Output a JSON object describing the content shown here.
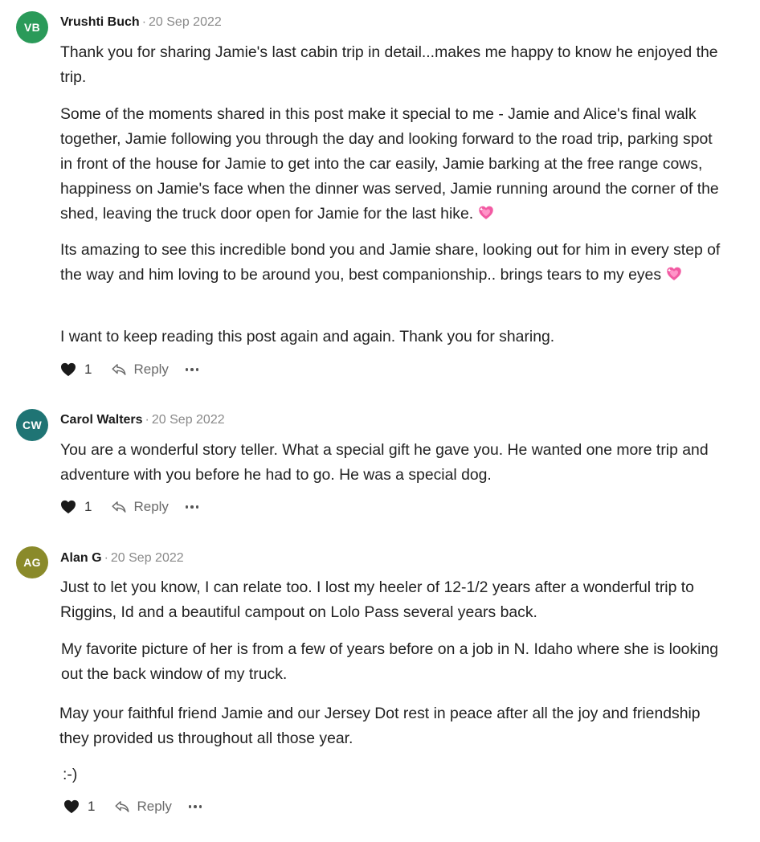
{
  "colors": {
    "avatar_vb": "#2a9a59",
    "avatar_cw": "#1f7474",
    "avatar_ag": "#8a8a2a",
    "heart": "#1a1a1a",
    "emoji_heart": "#f25ba3"
  },
  "icons": {
    "like": "heart-icon",
    "reply": "reply-arrow-icon",
    "more": "ellipsis-icon",
    "emoji": "sparkling-heart-emoji"
  },
  "comments": [
    {
      "initials": "VB",
      "author": "Vrushti Buch",
      "separator": "·",
      "date": "20 Sep 2022",
      "paragraphs": [
        "Thank you for sharing Jamie's last cabin trip in detail...makes me happy to know he enjoyed the trip.",
        "Some of the moments shared in this post make it special to me - Jamie and Alice's final walk together, Jamie following you through the day and looking forward to the road trip, parking spot in front of the house for Jamie to get into the car easily, Jamie barking at the free range cows, happiness on Jamie's face when the dinner was served, Jamie running around the corner of the shed, leaving the truck door open for Jamie for the last hike.",
        "Its amazing to see this incredible bond you and Jamie share, looking out for him in every step of the way and him loving to be around you, best companionship.. brings tears to my eyes",
        "I want to keep reading this post again and again. Thank you for sharing."
      ],
      "likes": "1",
      "reply_label": "Reply"
    },
    {
      "initials": "CW",
      "author": "Carol Walters",
      "separator": "·",
      "date": "20 Sep 2022",
      "paragraphs": [
        "You are a wonderful story teller. What a special gift he gave you. He wanted one more trip and adventure with you before he had to go. He was a special dog."
      ],
      "likes": "1",
      "reply_label": "Reply"
    },
    {
      "initials": "AG",
      "author": "Alan G",
      "separator": "·",
      "date": "20 Sep 2022",
      "paragraphs": [
        "Just to let you know, I can relate too. I lost my heeler of 12-1/2 years after a wonderful trip to Riggins, Id and a beautiful campout on Lolo Pass several years back.",
        "My favorite picture of her is from a few of years before on a job in N. Idaho where she is looking out the back window of my truck.",
        "May your faithful friend Jamie and our Jersey Dot rest in peace after all the joy and friendship they provided us throughout all those year.",
        ":-)"
      ],
      "likes": "1",
      "reply_label": "Reply"
    }
  ]
}
